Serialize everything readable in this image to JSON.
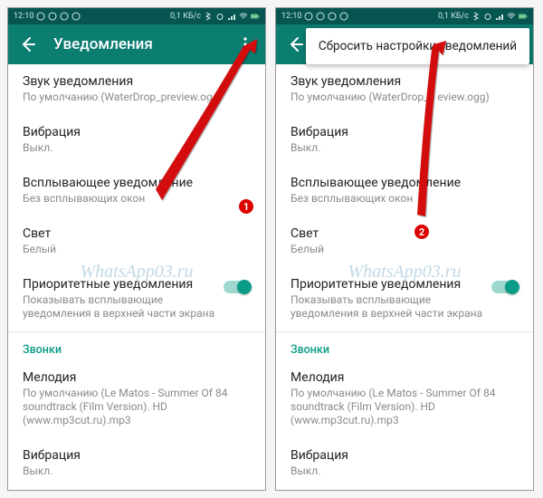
{
  "statusbar": {
    "time": "12:10",
    "net_speed": "0,1 КБ/с"
  },
  "appbar": {
    "title": "Уведомления"
  },
  "menu": {
    "reset_label": "Сбросить настройки уведомлений"
  },
  "settings": {
    "sound": {
      "title": "Звук уведомления",
      "value": "По умолчанию (WaterDrop_preview.ogg)"
    },
    "vibration": {
      "title": "Вибрация",
      "value": "Выкл."
    },
    "popup": {
      "title": "Всплывающее уведомление",
      "value": "Без всплывающих окон"
    },
    "light": {
      "title": "Свет",
      "value": "Белый"
    },
    "priority": {
      "title": "Приоритетные уведомления",
      "value": "Показывать всплывающие уведомления в верхней части экрана"
    }
  },
  "calls": {
    "header": "Звонки",
    "melody": {
      "title": "Мелодия",
      "value": "По умолчанию (Le Matos - Summer Of 84 soundtrack (Film Version). HD (www.mp3cut.ru).mp3"
    },
    "vibration": {
      "title": "Вибрация",
      "value": "Выкл."
    }
  },
  "watermark": "WhatsApp03.ru",
  "badges": {
    "one": "1",
    "two": "2"
  },
  "right_sound_value": "По умолчанию (WaterDrop_p    eview.ogg)"
}
